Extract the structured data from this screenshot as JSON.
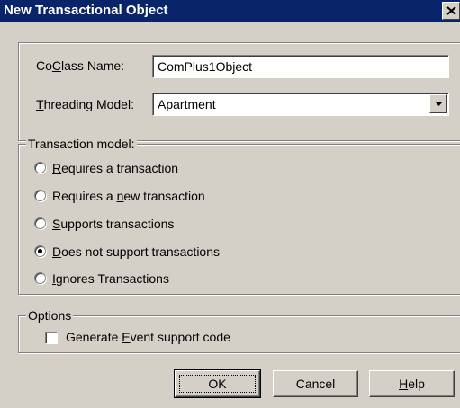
{
  "window": {
    "title": "New Transactional Object",
    "close_label": "×"
  },
  "coclass": {
    "label_pre": "Co",
    "label_accel": "C",
    "label_post": "lass Name:",
    "value": "ComPlus1Object"
  },
  "threading": {
    "label_accel": "T",
    "label_post": "hreading Model:",
    "value": "Apartment"
  },
  "transaction": {
    "legend": "Transaction model:",
    "options": [
      {
        "pre": "",
        "accel": "R",
        "post": "equires a transaction",
        "selected": false
      },
      {
        "pre": "Requires a ",
        "accel": "n",
        "post": "ew transaction",
        "selected": false
      },
      {
        "pre": "",
        "accel": "S",
        "post": "upports transactions",
        "selected": false
      },
      {
        "pre": "",
        "accel": "D",
        "post": "oes not support transactions",
        "selected": true
      },
      {
        "pre": "",
        "accel": "I",
        "post": "gnores Transactions",
        "selected": false
      }
    ]
  },
  "options": {
    "legend": "Options",
    "event_pre": "Generate ",
    "event_accel": "E",
    "event_post": "vent support code",
    "event_checked": false
  },
  "buttons": {
    "ok": "OK",
    "cancel": "Cancel",
    "help_accel": "H",
    "help_post": "elp"
  }
}
